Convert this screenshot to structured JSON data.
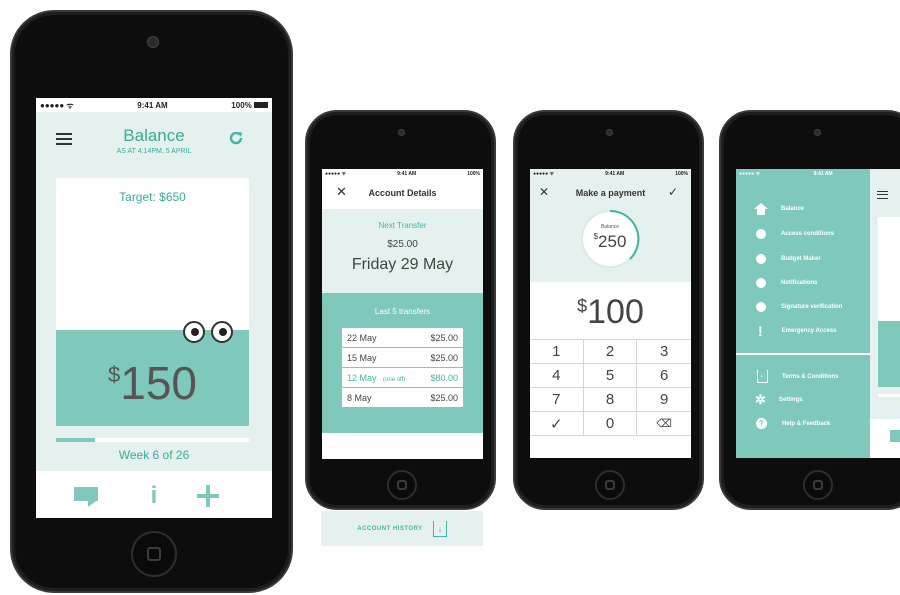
{
  "status": {
    "time": "9:41 AM",
    "battery": "100%",
    "signal": "●●●●● ᯤ"
  },
  "colors": {
    "accent": "#47b3a2",
    "panel": "#7ec8bc",
    "light": "#e5f1ef"
  },
  "balance_screen": {
    "title": "Balance",
    "subtitle": "AS AT 4:14PM, 5 APRIL",
    "target": "Target: $650",
    "currency": "$",
    "amount": "150",
    "progress_fraction": 0.2,
    "week": "Week 6 of 26",
    "icons": [
      "menu-icon",
      "refresh-icon",
      "chat-icon",
      "info-icon",
      "plus-icon"
    ]
  },
  "account_details": {
    "title": "Account Details",
    "next_label": "Next Transfer",
    "next_amount": "$25.00",
    "next_date": "Friday 29 May",
    "last_label": "Last 5 transfers",
    "transfers": [
      {
        "date": "22 May",
        "note": "",
        "amount": "$25.00"
      },
      {
        "date": "15 May",
        "note": "",
        "amount": "$25.00"
      },
      {
        "date": "12 May",
        "note": "(one off)",
        "amount": "$80.00"
      },
      {
        "date": "8 May",
        "note": "",
        "amount": "$25.00"
      }
    ],
    "history_button": "ACCOUNT HISTORY"
  },
  "payment": {
    "title": "Make a payment",
    "balance_label": "Balance",
    "balance_currency": "$",
    "balance_amount": "250",
    "currency": "$",
    "amount": "100",
    "keys": [
      "1",
      "2",
      "3",
      "4",
      "5",
      "6",
      "7",
      "8",
      "9",
      "✓",
      "0",
      "⌫"
    ]
  },
  "menu": {
    "items": [
      "Balance",
      "Access conditions",
      "Budget Maker",
      "Notifications",
      "Signature verification",
      "Emergency Access"
    ],
    "footer_items": [
      "Terms & Conditions",
      "Settings",
      "Help & Feedback"
    ]
  }
}
